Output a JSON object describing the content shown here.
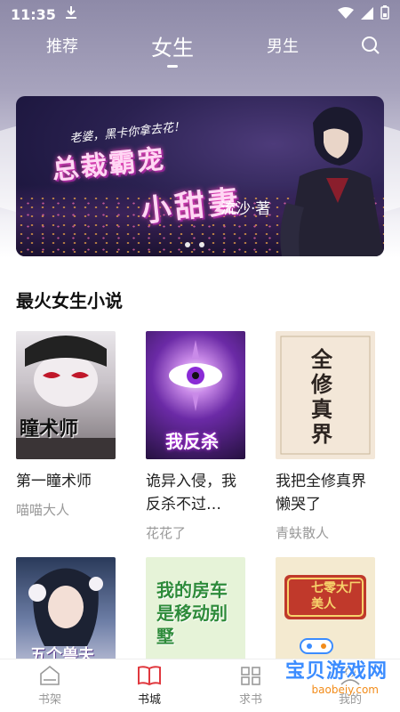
{
  "status_bar": {
    "time": "11:35"
  },
  "top_nav": {
    "tabs": [
      "推荐",
      "女生",
      "男生"
    ],
    "active_tab": "女生"
  },
  "banner": {
    "tagline": "老婆，黑卡你拿去花！",
    "title_line1": "总裁霸宠",
    "title_line2": "小甜妻",
    "author": "流沙·著",
    "page_count": 2
  },
  "section": {
    "title": "最火女生小说"
  },
  "books": [
    {
      "title": "第一瞳术师",
      "author": "喵喵大人",
      "cover_text": "瞳术师"
    },
    {
      "title": "诡异入侵，我反杀不过…",
      "author": "花花了",
      "cover_text": "我反杀"
    },
    {
      "title": "我把全修真界懒哭了",
      "author": "青蚨散人",
      "cover_text": "全修真界"
    },
    {
      "title": "",
      "author": "",
      "cover_text": "五个兽夫"
    },
    {
      "title": "",
      "author": "",
      "cover_text": "我的房车是移动别墅"
    },
    {
      "title": "",
      "author": "",
      "cover_text": "七零大厂美人"
    }
  ],
  "bottom_nav": {
    "items": [
      "书架",
      "书城",
      "求书",
      "我的"
    ],
    "active": "书城"
  },
  "watermark": {
    "main": "宝贝游戏网",
    "sub": "baobeiy.com"
  },
  "colors": {
    "accent": "#e0383e",
    "nav_text": "#ffffff",
    "muted": "#999999"
  }
}
